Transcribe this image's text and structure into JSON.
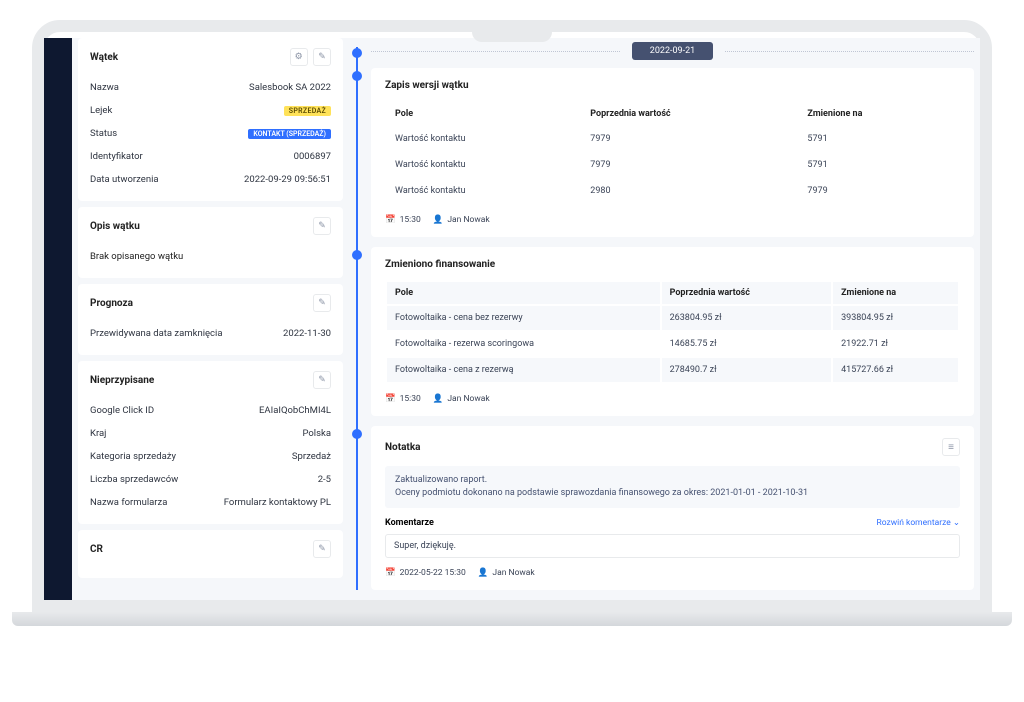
{
  "timeline_date": "2022-09-21",
  "thread": {
    "title": "Wątek",
    "fields": {
      "name_l": "Nazwa",
      "name_v": "Salesbook SA 2022",
      "funnel_l": "Lejek",
      "funnel_v": "SPRZEDAŻ",
      "status_l": "Status",
      "status_v": "KONTAKT (SPRZEDAŻ)",
      "id_l": "Identyfikator",
      "id_v": "0006897",
      "created_l": "Data utworzenia",
      "created_v": "2022-09-29 09:56:51"
    }
  },
  "desc": {
    "title": "Opis wątku",
    "empty": "Brak opisanego wątku"
  },
  "forecast": {
    "title": "Prognoza",
    "close_l": "Przewidywana data zamknięcia",
    "close_v": "2022-11-30"
  },
  "unassigned": {
    "title": "Nieprzypisane",
    "gclid_l": "Google Click ID",
    "gclid_v": "EAIaIQobChMI4L",
    "country_l": "Kraj",
    "country_v": "Polska",
    "cat_l": "Kategoria sprzedaży",
    "cat_v": "Sprzedaż",
    "sellers_l": "Liczba sprzedawców",
    "sellers_v": "2-5",
    "form_l": "Nazwa formularza",
    "form_v": "Formularz kontaktowy PL",
    "cr_title": "CR"
  },
  "version": {
    "title": "Zapis wersji wątku",
    "h1": "Pole",
    "h2": "Poprzednia wartość",
    "h3": "Zmienione na",
    "r1c1": "Wartość kontaktu",
    "r1c2": "7979",
    "r1c3": "5791",
    "r2c1": "Wartość kontaktu",
    "r2c2": "7979",
    "r2c3": "5791",
    "r3c1": "Wartość kontaktu",
    "r3c2": "2980",
    "r3c3": "7979",
    "time": "15:30",
    "user": "Jan Nowak"
  },
  "finance": {
    "title": "Zmieniono finansowanie",
    "h1": "Pole",
    "h2": "Poprzednia wartość",
    "h3": "Zmienione na",
    "r1c1": "Fotowoltaika - cena bez rezerwy",
    "r1c2": "263804.95 zł",
    "r1c3": "393804.95 zł",
    "r2c1": "Fotowoltaika - rezerwa scoringowa",
    "r2c2": "14685.75 zł",
    "r2c3": "21922.71 zł",
    "r3c1": "Fotowoltaika - cena z rezerwą",
    "r3c2": "278490.7 zł",
    "r3c3": "415727.66 zł",
    "time": "15:30",
    "user": "Jan Nowak"
  },
  "note": {
    "title": "Notatka",
    "line1": "Zaktualizowano raport.",
    "line2": "Oceny podmiotu dokonano na podstawie sprawozdania finansowego za okres: 2021-01-01 - 2021-10-31",
    "comments_title": "Komentarze",
    "expand": "Rozwiń komentarze ⌄",
    "comment": "Super, dziękuję.",
    "time": "2022-05-22 15:30",
    "user": "Jan Nowak"
  }
}
